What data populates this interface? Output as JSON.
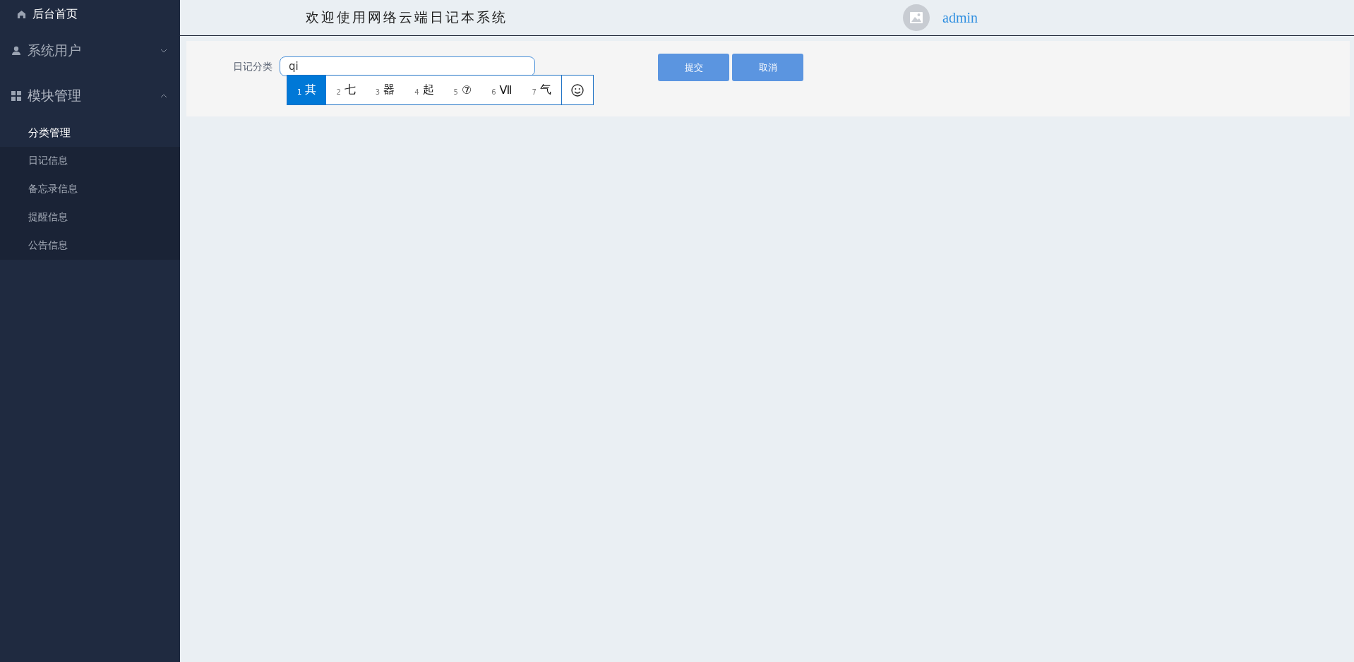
{
  "sidebar": {
    "items": [
      {
        "label": "后台首页",
        "kind": "link"
      },
      {
        "label": "系统用户",
        "kind": "group",
        "expanded": false
      },
      {
        "label": "模块管理",
        "kind": "group",
        "expanded": true,
        "children": [
          {
            "label": "分类管理",
            "selected": true
          },
          {
            "label": "日记信息",
            "selected": false
          },
          {
            "label": "备忘录信息",
            "selected": false
          },
          {
            "label": "提醒信息",
            "selected": false
          },
          {
            "label": "公告信息",
            "selected": false
          }
        ]
      }
    ]
  },
  "header": {
    "title": "欢迎使用网络云端日记本系统",
    "user": "admin"
  },
  "form": {
    "field_label": "日记分类",
    "value": "qi",
    "buttons": [
      {
        "label": "提交"
      },
      {
        "label": "取消"
      }
    ]
  },
  "ime": {
    "candidates": [
      {
        "number": "1",
        "text": "其",
        "selected": true
      },
      {
        "number": "2",
        "text": "七",
        "selected": false
      },
      {
        "number": "3",
        "text": "器",
        "selected": false
      },
      {
        "number": "4",
        "text": "起",
        "selected": false
      },
      {
        "number": "5",
        "text": "⑦",
        "selected": false
      },
      {
        "number": "6",
        "text": "Ⅶ",
        "selected": false
      },
      {
        "number": "7",
        "text": "气",
        "selected": false
      }
    ]
  }
}
